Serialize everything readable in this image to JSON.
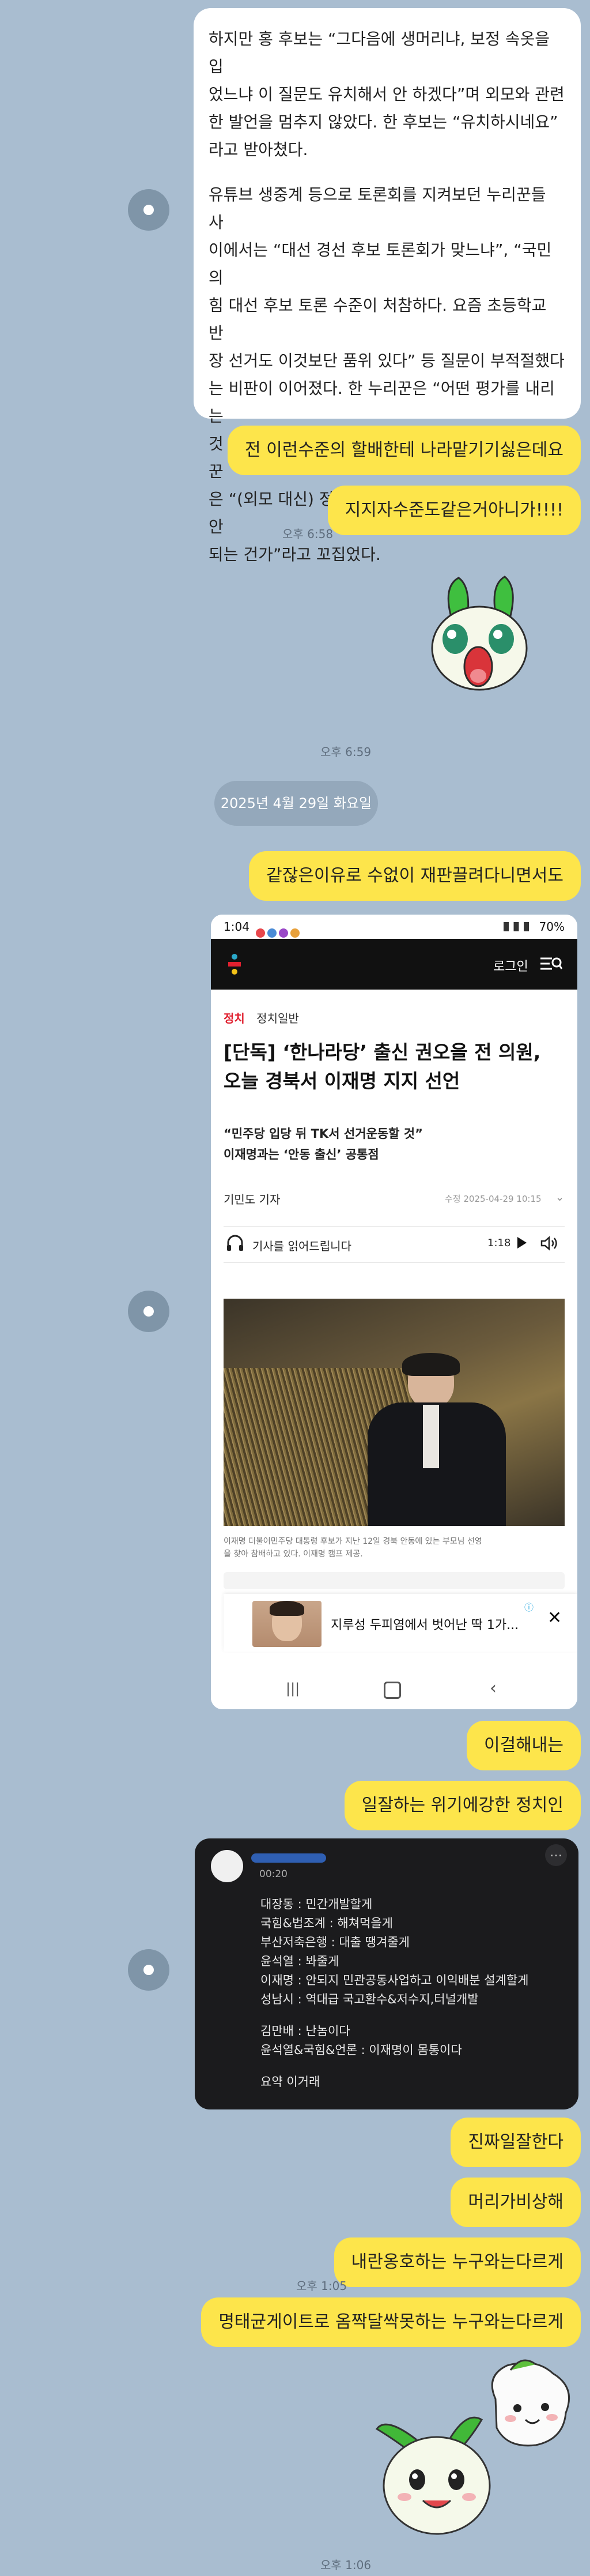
{
  "messages": {
    "top_article_text": [
      "하지만 홍 후보는 “그다음에 생머리냐, 보정 속옷을 입",
      "었느냐 이 질문도 유치해서 안 하겠다”며 외모와 관련",
      "한 발언을 멈추지 않았다. 한 후보는 “유치하시네요”",
      "라고 받아쳤다.",
      "",
      "유튜브 생중계 등으로 토론회를 지켜보던 누리꾼들 사",
      "이에서는 “대선 경선 후보 토론회가 맞느냐”, “국민의",
      "힘 대선 후보 토론 수준이 처참하다. 요즘 초등학교 반",
      "장 선거도 이것보단 품위 있다” 등 질문이 부적절했다",
      "는 비판이 이어졌다. 한 누리꾼은 “어떤 평가를 내리는",
      "것 자체가 치욕스러울 정도”라고 했고, 또 다른 누리꾼",
      "은 “(외모 대신) 정책, 철학, 신념 등을 묻는 수준은 안",
      "되는 건가”라고 꼬집었다."
    ],
    "reply1": "전 이런수준의 할배한테 나라맡기기싫은데요",
    "reply2": "지지자수준도같은거아니가!!!!",
    "time1": "오후 6:58",
    "time2": "오후 6:59",
    "date_divider": "2025년 4월 29일 화요일",
    "reply3": "같잖은이유로 수없이 재판끌려다니면서도",
    "reply4": "이걸해내는",
    "reply5": "일잘하는 위기에강한 정치인",
    "reply6": "진짜일잘한다",
    "reply7": "머리가비상해",
    "reply8": "내란옹호하는 누구와는다르게",
    "time3": "오후 1:05",
    "reply9": "명태균게이트로 옴짝달싹못하는 누구와는다르게",
    "time4": "오후 1:06"
  },
  "phone": {
    "status_time": "1:04",
    "status_battery": "70%",
    "login": "로그인",
    "category": "정치",
    "subcategory": "정치일반",
    "headline_line1": "[단독] ‘한나라당’ 출신 권오을 전 의원,",
    "headline_line2": "오늘 경북서 이재명 지지 선언",
    "sub_line1": "“민주당 입당 뒤 TK서 선거운동할 것”",
    "sub_line2": "이재명과는 ‘안동 출신’ 공통점",
    "reporter": "기민도 기자",
    "date": "수정 2025-04-29 10:15",
    "listen": "기사를 읽어드립니다",
    "duration": "1:18",
    "caption_line1": "이재명 더불어민주당 대통령 후보가 지난 12일 경북 안동에 있는 부모님 선영",
    "caption_line2": "을 찾아 참배하고 있다. 이재명 캠프 제공.",
    "ad_text": "지루성 두피염에서 벗어난 딱 1가..."
  },
  "dark_post": {
    "time_label": "00:20",
    "lines": [
      "대장동 : 민간개발할게",
      "국힘&법조계 : 해쳐먹을게",
      "부산저축은행 : 대출 땡겨줄게",
      "윤석열 : 봐줄게",
      "이재명 : 안되지 민관공동사업하고 이익배분 설계할게",
      "성남시 : 역대급 국고환수&저수지,터널개발",
      "",
      "김만배 : 난놈이다",
      "윤석열&국힘&언론 : 이재명이 몸통이다",
      "",
      "요약 이거래"
    ]
  },
  "colors": {
    "background": "#a9bdd0",
    "my_bubble": "#fde54b",
    "other_bubble": "#ffffff",
    "category_red": "#e0202f"
  }
}
